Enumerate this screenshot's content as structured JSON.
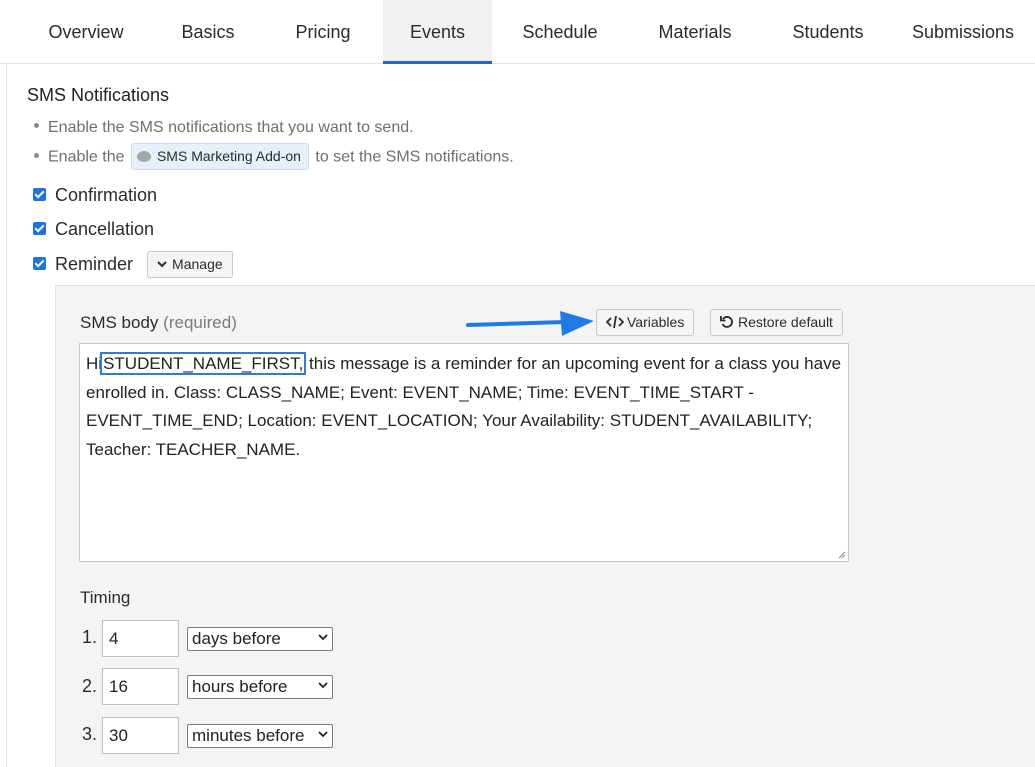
{
  "tabs": [
    {
      "label": "Overview"
    },
    {
      "label": "Basics"
    },
    {
      "label": "Pricing"
    },
    {
      "label": "Events",
      "active": true
    },
    {
      "label": "Schedule"
    },
    {
      "label": "Materials"
    },
    {
      "label": "Students"
    },
    {
      "label": "Submissions"
    }
  ],
  "sms": {
    "title": "SMS Notifications",
    "bullet1": "Enable the SMS notifications that you want to send.",
    "bullet2_pre": "Enable the",
    "addon_label": "SMS Marketing Add-on",
    "bullet2_post": "to set the SMS notifications.",
    "confirmation_label": "Confirmation",
    "cancellation_label": "Cancellation",
    "reminder_label": "Reminder",
    "manage_label": "Manage"
  },
  "reminder": {
    "body_label": "SMS body",
    "body_required": "(required)",
    "variables_label": "Variables",
    "restore_label": "Restore default",
    "body_prefix": "Hi",
    "body_variable": "STUDENT_NAME_FIRST,",
    "body_rest": " this message is a reminder for an upcoming event for a class you have enrolled in. Class: CLASS_NAME; Event: EVENT_NAME; Time: EVENT_TIME_START - EVENT_TIME_END; Location: EVENT_LOCATION; Your Availability: STUDENT_AVAILABILITY; Teacher: TEACHER_NAME.",
    "timing_label": "Timing",
    "timing": [
      {
        "num": "1.",
        "value": "4",
        "unit": "days before"
      },
      {
        "num": "2.",
        "value": "16",
        "unit": "hours before"
      },
      {
        "num": "3.",
        "value": "30",
        "unit": "minutes before"
      }
    ]
  },
  "colors": {
    "accent": "#2a62c9",
    "checkbox": "#1a73e8",
    "annotation_arrow": "#1f7ae8",
    "badge_bg": "#e6f0fb",
    "panel_bg": "#f4f4f4"
  },
  "icons": {
    "addon": "chat-bubble-icon",
    "manage": "chevron-down-icon",
    "variables": "code-icon",
    "restore": "restore-icon",
    "select": "chevron-down-icon",
    "annotation": "arrow-right-icon"
  }
}
